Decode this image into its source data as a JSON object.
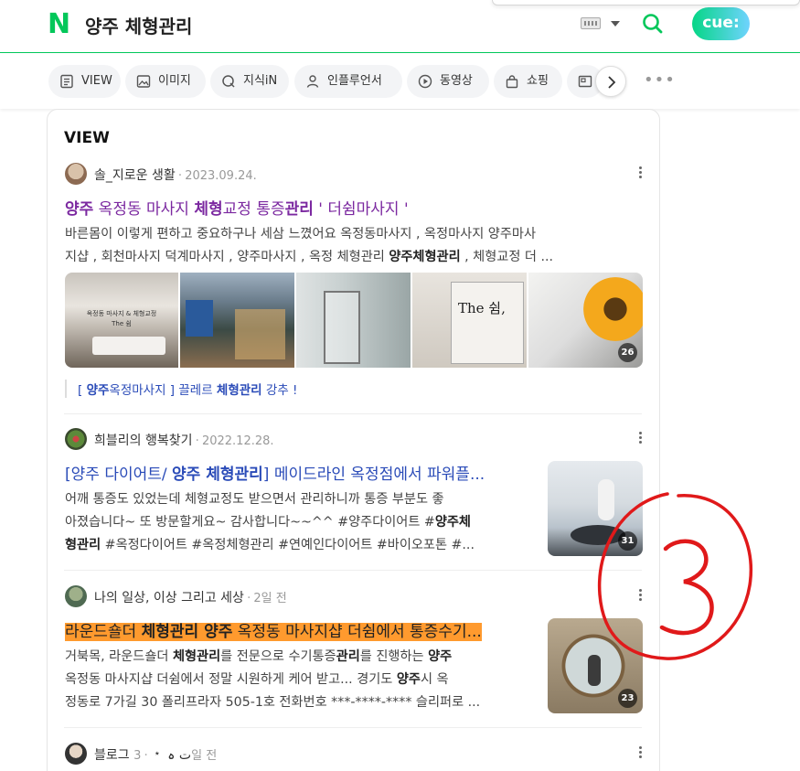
{
  "header": {
    "logo": "N",
    "query": "양주 체형관리",
    "cue_label": "cue:"
  },
  "tabs": [
    {
      "label": "VIEW",
      "icon": "view-icon"
    },
    {
      "label": "이미지",
      "icon": "image-icon"
    },
    {
      "label": "지식iN",
      "icon": "knowledge-icon"
    },
    {
      "label": "인플루언서",
      "icon": "person-icon"
    },
    {
      "label": "동영상",
      "icon": "play-icon"
    },
    {
      "label": "쇼핑",
      "icon": "bag-icon"
    }
  ],
  "section_title": "VIEW",
  "posts": [
    {
      "author": "솔_지로운 생활",
      "date": "2023.09.24.",
      "title_parts": [
        "양주",
        " 옥정동 마사지 ",
        "체형",
        "교정 통증",
        "관리",
        " ' 더쉼마사지 '"
      ],
      "title_prefix_bracket": "",
      "desc_lines": [
        "바른몸이 이렇게 편하고 중요하구나 세삼 느꼈어요 옥정동마사지 , 옥정마사지 양주마사",
        "지샵 , 회천마사지 덕계마사지 , 양주마사지 , 옥정 체형관리 ",
        "양주체형관리",
        " , 체형교정 더 ..."
      ],
      "image_count": "26",
      "image_text_1": "옥정동 마사지 & 체형교정\nThe 쉼",
      "image_text_3": "The 쉼,",
      "sublink": [
        "[ ",
        "양주",
        "옥정마사지 ] 끌레르 ",
        "체형관리",
        " 강추 !"
      ]
    },
    {
      "author": "희블리의 행복찾기",
      "date": "2022.12.28.",
      "title_parts": [
        "[양주 다이어트/ ",
        "양주 체형관리",
        "] 메이드라인 옥정점에서 파워플..."
      ],
      "desc_lines": [
        "어깨 통증도 있었는데 체형교정도 받으면서 관리하니까 통증 부분도 좋",
        "아졌습니다~ 또 방문할게요~ 감사합니다~~^^ #양주다이어트 #",
        "양주체",
        "형관리",
        " #옥정다이어트 #옥정체형관리 #연예인다이어트 #바이오포톤 #..."
      ],
      "image_count": "31"
    },
    {
      "author": "나의 일상, 이상 그리고 세상",
      "date": "2일 전",
      "title_parts": [
        "라운드숄더 ",
        "체형관리 양주",
        " 옥정동 마사지샵 더쉼에서 통증수기..."
      ],
      "desc_lines": [
        "거북목, 라운드숄더 ",
        "체형관리",
        "를 전문으로 수기통증",
        "관리",
        "를 진행하는 ",
        "양주",
        "옥정동 마사지샵 더쉼에서 정말 시원하게 케어 받고... 경기도 ",
        "양주",
        "시 옥",
        "정동로 7가길 30 폴리프라자 505-1호 전화번호 ***-****-**** 슬리퍼로 ..."
      ],
      "image_count": "23"
    },
    {
      "author": "블로그 ت ہ ﹡",
      "date": "3일 전"
    }
  ],
  "annotation_mark": "3",
  "colors": {
    "naver_green": "#03c75a",
    "keyword_purple": "#7b28a0",
    "link_blue": "#2a4bb8",
    "highlight_orange": "#ff9a2e",
    "annotation_red": "#e0191a"
  }
}
